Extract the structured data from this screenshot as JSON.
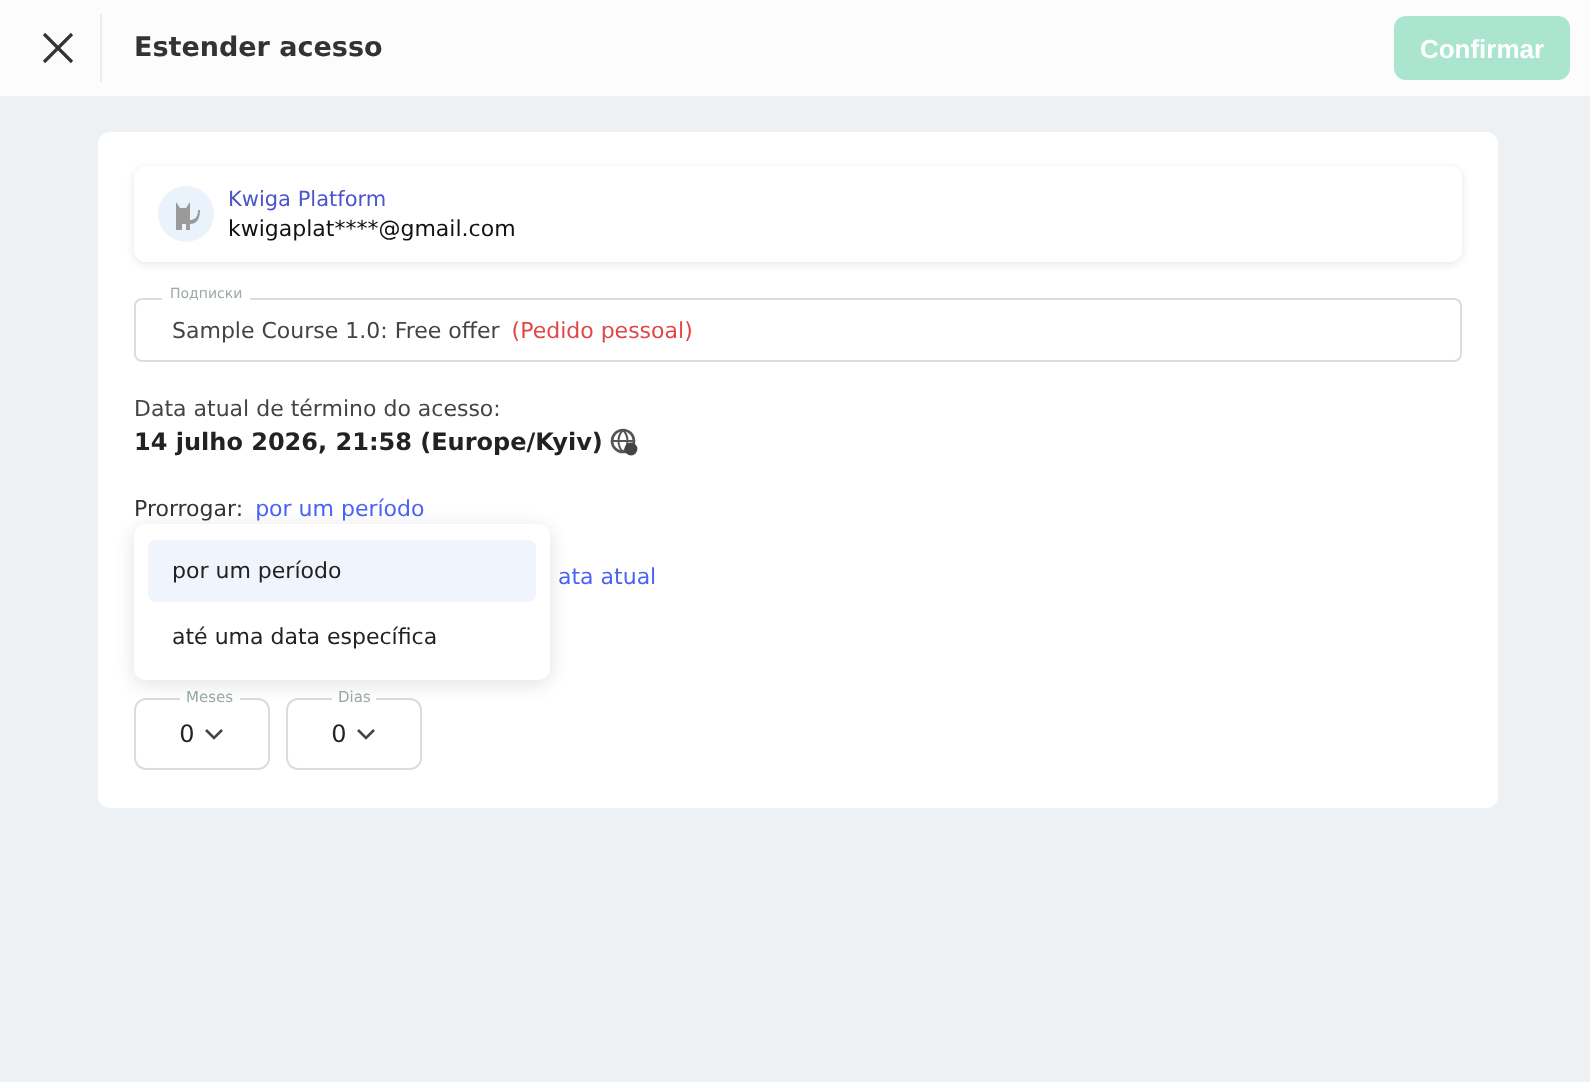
{
  "header": {
    "title": "Estender acesso",
    "confirm_button": {
      "label": "Confirmar",
      "disabled": true
    }
  },
  "user": {
    "name": "Kwiga Platform",
    "email": "kwigaplat****@gmail.com"
  },
  "subscription_field": {
    "label": "Подписки",
    "value": "Sample Course 1.0: Free offer",
    "note": "(Pedido pessoal)"
  },
  "current_end": {
    "label": "Data atual de término do acesso:",
    "value": "14 julho 2026, 21:58 (Europe/Kyiv)"
  },
  "extend": {
    "label": "Prorrogar:",
    "value": "por um período",
    "expanded": true,
    "options": [
      {
        "label": "por um período",
        "selected": true
      },
      {
        "label": "até uma data específica",
        "selected": false
      }
    ]
  },
  "from_link": "ata atual",
  "period_fields": [
    {
      "label": "Meses",
      "value": "0"
    },
    {
      "label": "Dias",
      "value": "0"
    }
  ]
}
